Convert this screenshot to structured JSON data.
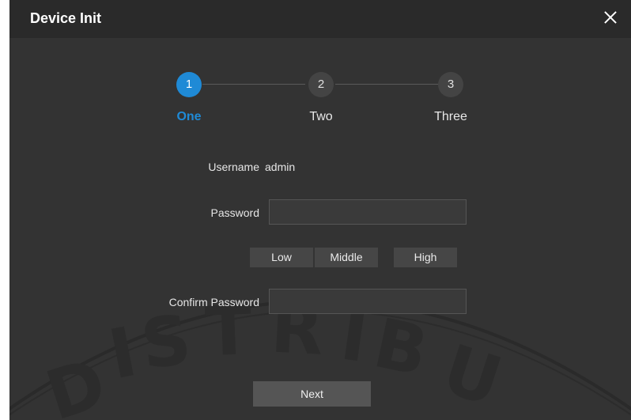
{
  "dialog": {
    "title": "Device Init"
  },
  "steps": [
    {
      "number": "1",
      "label": "One",
      "active": true
    },
    {
      "number": "2",
      "label": "Two",
      "active": false
    },
    {
      "number": "3",
      "label": "Three",
      "active": false
    }
  ],
  "form": {
    "username_label": "Username",
    "username_value": "admin",
    "password_label": "Password",
    "password_value": "",
    "strength_levels": [
      "Low",
      "Middle",
      "High"
    ],
    "confirm_password_label": "Confirm Password",
    "confirm_password_value": ""
  },
  "actions": {
    "next_label": "Next"
  },
  "watermark": {
    "text": "DISTRIBU"
  },
  "colors": {
    "accent": "#1f8ad6",
    "panel_bg": "#333333",
    "titlebar_bg": "#2a2a2a"
  }
}
